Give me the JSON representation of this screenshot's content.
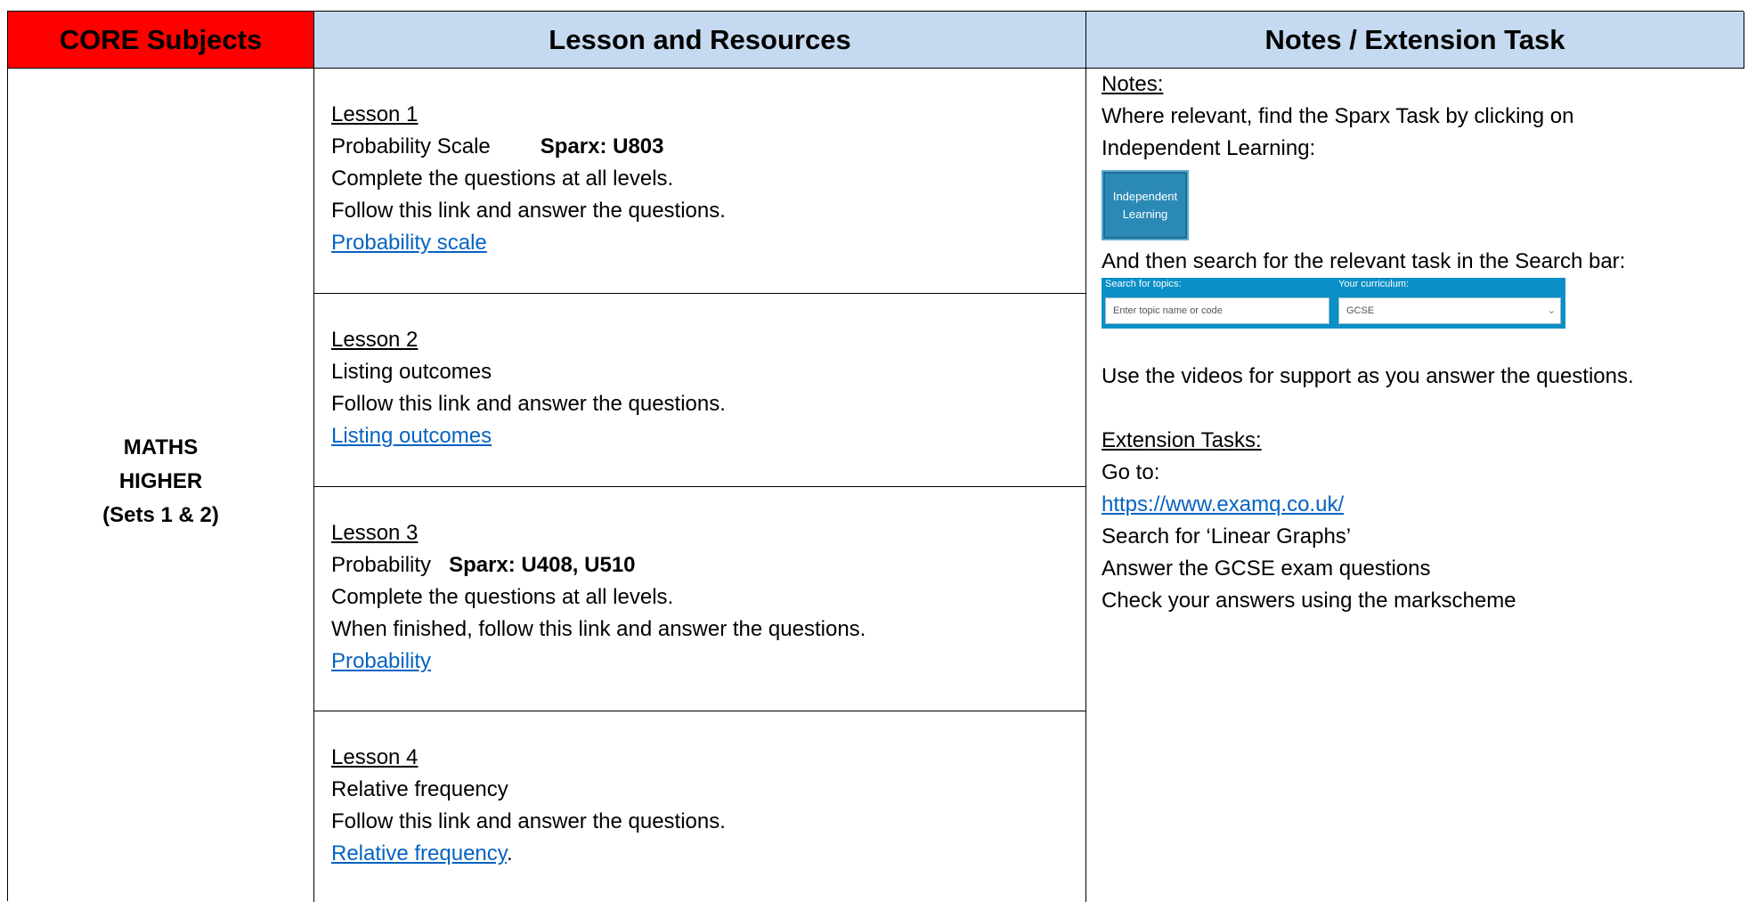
{
  "headers": {
    "core": "CORE Subjects",
    "lesson": "Lesson and Resources",
    "notes": "Notes / Extension Task"
  },
  "subject": {
    "line1": "MATHS",
    "line2": "HIGHER",
    "line3": "(Sets 1 & 2)"
  },
  "lessons": [
    {
      "title": "Lesson 1",
      "topic": "Probability Scale",
      "sparx": "Sparx: U803",
      "line1": "Complete the questions at all levels.",
      "line2": "Follow this link and answer the questions.",
      "link": "Probability scale",
      "suffix": ""
    },
    {
      "title": "Lesson 2",
      "topic": "Listing outcomes",
      "sparx": "",
      "line1": "Follow this link and answer the questions.",
      "line2": "",
      "link": "Listing outcomes",
      "suffix": ""
    },
    {
      "title": "Lesson 3",
      "topic": "Probability",
      "sparx": "Sparx: U408, U510",
      "line1": "Complete the questions at all levels.",
      "line2": "When finished, follow this link and answer the questions.",
      "link": "Probability",
      "suffix": ""
    },
    {
      "title": "Lesson 4",
      "topic": "Relative frequency",
      "sparx": "",
      "line1": "Follow this link and answer the questions.",
      "line2": "",
      "link": "Relative frequency",
      "suffix": "."
    }
  ],
  "notes": {
    "heading": "Notes:",
    "line1": "Where relevant, find the Sparx Task by clicking on",
    "line2": "Independent Learning:",
    "il_button_line1": "Independent",
    "il_button_line2": "Learning",
    "search_intro": "And then search for the relevant task in the Search bar:",
    "search_label_topics": "Search for topics:",
    "search_label_curriculum": "Your curriculum:",
    "search_placeholder": "Enter topic name or code",
    "curriculum_value": "GCSE",
    "videos": "Use the videos for support as you answer the questions.",
    "ext_heading": "Extension Tasks:",
    "ext_line1": "Go to:",
    "ext_link": "https://www.examq.co.uk/",
    "ext_line2": "Search for ‘Linear Graphs’",
    "ext_line3": "Answer the GCSE exam questions",
    "ext_line4": "Check your answers using the markscheme"
  },
  "colors": {
    "core_header_bg": "#ff0000",
    "header_bg": "#c5d9f0",
    "link": "#0563c1",
    "sparx_blue": "#0a8fc6"
  }
}
